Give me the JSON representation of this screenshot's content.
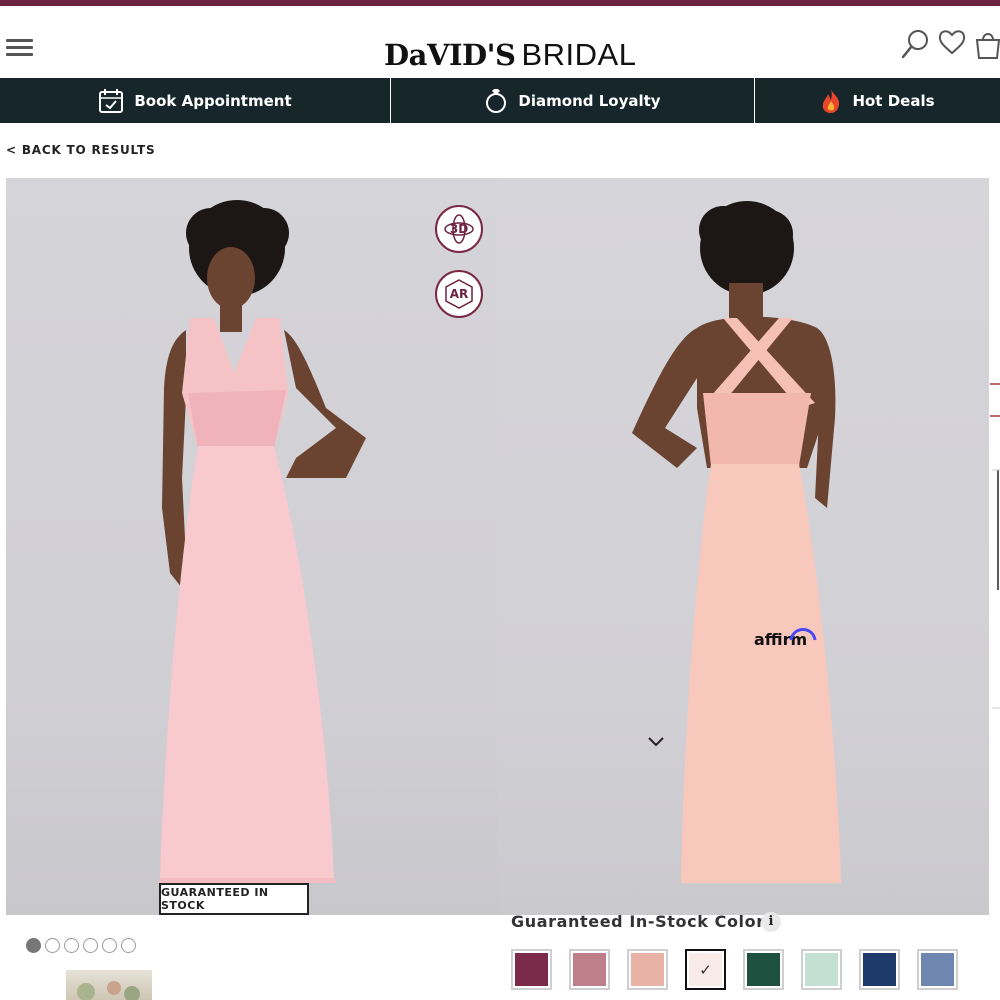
{
  "brand": {
    "logo_part1": "DaVID'S",
    "logo_part2": "BRIDAL",
    "accent": "#6d2340",
    "nav_bg": "#16262a"
  },
  "header_icons": [
    "menu-icon",
    "search-icon",
    "heart-icon",
    "cart-icon"
  ],
  "nav": {
    "book_label": "Book Appointment",
    "loyalty_label": "Diamond Loyalty",
    "deals_label": "Hot Deals"
  },
  "back_link": "< BACK TO RESULTS",
  "gallery": {
    "btn_3d": "3D",
    "btn_ar": "AR",
    "stock_badge": "GUARANTEED IN STOCK",
    "affirm_label": "affirm",
    "dot_count": 6,
    "active_dot": 0
  },
  "colors": {
    "title": "Guaranteed In-Stock Colors",
    "info": "i",
    "selected_index": 3,
    "swatches": [
      {
        "name": "wine",
        "hex": "#7b2a4a"
      },
      {
        "name": "dusty-rose",
        "hex": "#be7f8a"
      },
      {
        "name": "blush",
        "hex": "#e8b2a7"
      },
      {
        "name": "petal",
        "hex": "#f9ece8"
      },
      {
        "name": "juniper",
        "hex": "#1d5240"
      },
      {
        "name": "mint",
        "hex": "#c4e0d2"
      },
      {
        "name": "marine",
        "hex": "#1d3a6b"
      },
      {
        "name": "dusk-blue",
        "hex": "#6f86b0"
      }
    ]
  }
}
